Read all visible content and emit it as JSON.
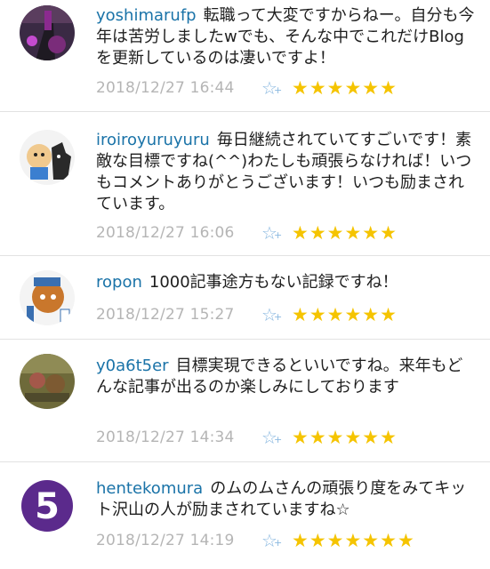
{
  "comments": [
    {
      "user": "yoshimarufp",
      "text": "転職って大変ですからねー。自分も今年は苦労しましたwでも、そんな中でこれだけBlogを更新しているのは凄いですよ！",
      "date": "2018/12/27 16:44",
      "stars": "★★★★★★",
      "add_star": "☆",
      "avatar_icon": "guitar-avatar-icon"
    },
    {
      "user": "iroiroyuruyuru",
      "text": "毎日継続されていてすごいです！素敵な目標ですね(^^)わたしも頑張らなければ！いつもコメントありがとうございます！いつも励まされています。",
      "date": "2018/12/27 16:06",
      "stars": "★★★★★★",
      "add_star": "☆",
      "avatar_icon": "cartoon-characters-avatar-icon"
    },
    {
      "user": "ropon",
      "text": "1000記事途方もない記録ですね！",
      "date": "2018/12/27 15:27",
      "stars": "★★★★★★",
      "add_star": "☆",
      "avatar_icon": "cartoon-creature-avatar-icon"
    },
    {
      "user": "y0a6t5er",
      "text": "目標実現できるといいですね。来年もどんな記事が出るのか楽しみにしております",
      "date": "2018/12/27 14:34",
      "stars": "★★★★★★",
      "add_star": "☆",
      "avatar_icon": "photo-avatar-icon"
    },
    {
      "user": "hentekomura",
      "text": "のムのムさんの頑張り度をみてキット沢山の人が励まされていますね☆",
      "date": "2018/12/27 14:19",
      "stars": "★★★★★★★",
      "add_star": "☆",
      "avatar_icon": "number-five-avatar-icon"
    }
  ],
  "colors": {
    "username": "#1a73a8",
    "date": "#b5b5b5",
    "star_filled": "#f5c400",
    "star_add": "#8ab8e0",
    "divider": "#e2e2e2"
  }
}
